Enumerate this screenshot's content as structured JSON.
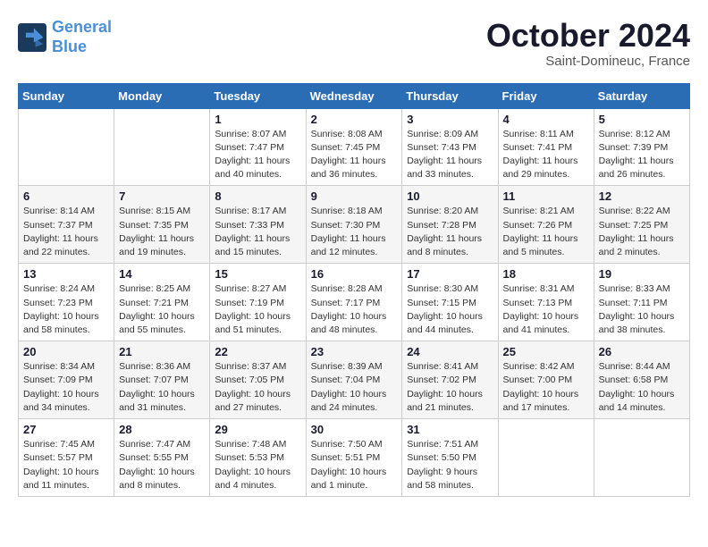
{
  "logo": {
    "line1": "General",
    "line2": "Blue"
  },
  "title": "October 2024",
  "subtitle": "Saint-Domineuc, France",
  "headers": [
    "Sunday",
    "Monday",
    "Tuesday",
    "Wednesday",
    "Thursday",
    "Friday",
    "Saturday"
  ],
  "weeks": [
    [
      {
        "day": "",
        "details": ""
      },
      {
        "day": "",
        "details": ""
      },
      {
        "day": "1",
        "details": "Sunrise: 8:07 AM\nSunset: 7:47 PM\nDaylight: 11 hours and 40 minutes."
      },
      {
        "day": "2",
        "details": "Sunrise: 8:08 AM\nSunset: 7:45 PM\nDaylight: 11 hours and 36 minutes."
      },
      {
        "day": "3",
        "details": "Sunrise: 8:09 AM\nSunset: 7:43 PM\nDaylight: 11 hours and 33 minutes."
      },
      {
        "day": "4",
        "details": "Sunrise: 8:11 AM\nSunset: 7:41 PM\nDaylight: 11 hours and 29 minutes."
      },
      {
        "day": "5",
        "details": "Sunrise: 8:12 AM\nSunset: 7:39 PM\nDaylight: 11 hours and 26 minutes."
      }
    ],
    [
      {
        "day": "6",
        "details": "Sunrise: 8:14 AM\nSunset: 7:37 PM\nDaylight: 11 hours and 22 minutes."
      },
      {
        "day": "7",
        "details": "Sunrise: 8:15 AM\nSunset: 7:35 PM\nDaylight: 11 hours and 19 minutes."
      },
      {
        "day": "8",
        "details": "Sunrise: 8:17 AM\nSunset: 7:33 PM\nDaylight: 11 hours and 15 minutes."
      },
      {
        "day": "9",
        "details": "Sunrise: 8:18 AM\nSunset: 7:30 PM\nDaylight: 11 hours and 12 minutes."
      },
      {
        "day": "10",
        "details": "Sunrise: 8:20 AM\nSunset: 7:28 PM\nDaylight: 11 hours and 8 minutes."
      },
      {
        "day": "11",
        "details": "Sunrise: 8:21 AM\nSunset: 7:26 PM\nDaylight: 11 hours and 5 minutes."
      },
      {
        "day": "12",
        "details": "Sunrise: 8:22 AM\nSunset: 7:25 PM\nDaylight: 11 hours and 2 minutes."
      }
    ],
    [
      {
        "day": "13",
        "details": "Sunrise: 8:24 AM\nSunset: 7:23 PM\nDaylight: 10 hours and 58 minutes."
      },
      {
        "day": "14",
        "details": "Sunrise: 8:25 AM\nSunset: 7:21 PM\nDaylight: 10 hours and 55 minutes."
      },
      {
        "day": "15",
        "details": "Sunrise: 8:27 AM\nSunset: 7:19 PM\nDaylight: 10 hours and 51 minutes."
      },
      {
        "day": "16",
        "details": "Sunrise: 8:28 AM\nSunset: 7:17 PM\nDaylight: 10 hours and 48 minutes."
      },
      {
        "day": "17",
        "details": "Sunrise: 8:30 AM\nSunset: 7:15 PM\nDaylight: 10 hours and 44 minutes."
      },
      {
        "day": "18",
        "details": "Sunrise: 8:31 AM\nSunset: 7:13 PM\nDaylight: 10 hours and 41 minutes."
      },
      {
        "day": "19",
        "details": "Sunrise: 8:33 AM\nSunset: 7:11 PM\nDaylight: 10 hours and 38 minutes."
      }
    ],
    [
      {
        "day": "20",
        "details": "Sunrise: 8:34 AM\nSunset: 7:09 PM\nDaylight: 10 hours and 34 minutes."
      },
      {
        "day": "21",
        "details": "Sunrise: 8:36 AM\nSunset: 7:07 PM\nDaylight: 10 hours and 31 minutes."
      },
      {
        "day": "22",
        "details": "Sunrise: 8:37 AM\nSunset: 7:05 PM\nDaylight: 10 hours and 27 minutes."
      },
      {
        "day": "23",
        "details": "Sunrise: 8:39 AM\nSunset: 7:04 PM\nDaylight: 10 hours and 24 minutes."
      },
      {
        "day": "24",
        "details": "Sunrise: 8:41 AM\nSunset: 7:02 PM\nDaylight: 10 hours and 21 minutes."
      },
      {
        "day": "25",
        "details": "Sunrise: 8:42 AM\nSunset: 7:00 PM\nDaylight: 10 hours and 17 minutes."
      },
      {
        "day": "26",
        "details": "Sunrise: 8:44 AM\nSunset: 6:58 PM\nDaylight: 10 hours and 14 minutes."
      }
    ],
    [
      {
        "day": "27",
        "details": "Sunrise: 7:45 AM\nSunset: 5:57 PM\nDaylight: 10 hours and 11 minutes."
      },
      {
        "day": "28",
        "details": "Sunrise: 7:47 AM\nSunset: 5:55 PM\nDaylight: 10 hours and 8 minutes."
      },
      {
        "day": "29",
        "details": "Sunrise: 7:48 AM\nSunset: 5:53 PM\nDaylight: 10 hours and 4 minutes."
      },
      {
        "day": "30",
        "details": "Sunrise: 7:50 AM\nSunset: 5:51 PM\nDaylight: 10 hours and 1 minute."
      },
      {
        "day": "31",
        "details": "Sunrise: 7:51 AM\nSunset: 5:50 PM\nDaylight: 9 hours and 58 minutes."
      },
      {
        "day": "",
        "details": ""
      },
      {
        "day": "",
        "details": ""
      }
    ]
  ]
}
